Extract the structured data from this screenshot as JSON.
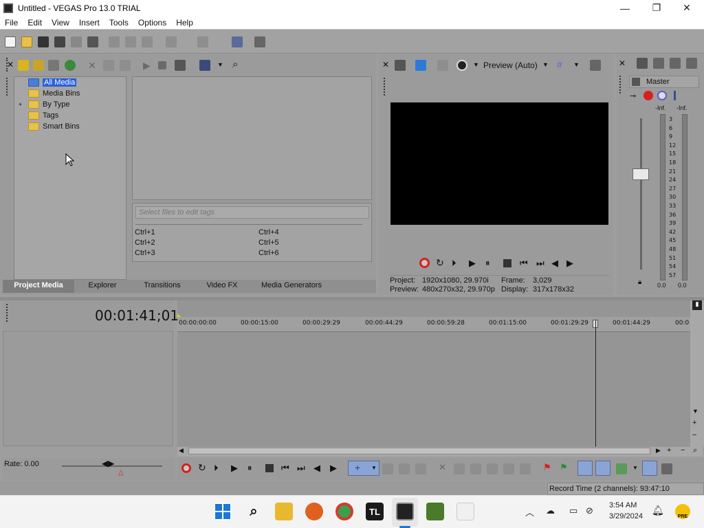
{
  "window": {
    "title": "Untitled - VEGAS Pro 13.0 TRIAL",
    "minimize": "—",
    "maximize": "❐",
    "close": "✕"
  },
  "menu": [
    "File",
    "Edit",
    "View",
    "Insert",
    "Tools",
    "Options",
    "Help"
  ],
  "project_media": {
    "tree": [
      {
        "label": "All Media",
        "selected": true,
        "expandable": false
      },
      {
        "label": "Media Bins",
        "selected": false,
        "expandable": false
      },
      {
        "label": "By Type",
        "selected": false,
        "expandable": true
      },
      {
        "label": "Tags",
        "selected": false,
        "expandable": false
      },
      {
        "label": "Smart Bins",
        "selected": false,
        "expandable": false
      }
    ],
    "tag_placeholder": "Select files to edit tags",
    "shortcuts": [
      "Ctrl+1",
      "Ctrl+2",
      "Ctrl+3",
      "Ctrl+4",
      "Ctrl+5",
      "Ctrl+6"
    ]
  },
  "tabs": [
    "Project Media",
    "Explorer",
    "Transitions",
    "Video FX",
    "Media Generators"
  ],
  "preview": {
    "mode": "Preview (Auto)",
    "project_label": "Project:",
    "project_value": "1920x1080, 29.970i",
    "preview_label": "Preview:",
    "preview_value": "480x270x32, 29.970p",
    "frame_label": "Frame:",
    "frame_value": "3,029",
    "display_label": "Display:",
    "display_value": "317x178x32"
  },
  "mixer": {
    "title": "Master",
    "left_peak": "-Inf.",
    "right_peak": "-Inf.",
    "scale": [
      "3",
      "6",
      "9",
      "12",
      "15",
      "18",
      "21",
      "24",
      "27",
      "30",
      "33",
      "36",
      "39",
      "42",
      "45",
      "48",
      "51",
      "54",
      "57"
    ],
    "left_value": "0.0",
    "right_value": "0.0"
  },
  "timeline": {
    "timecode": "00:01:41;01",
    "ruler": [
      "00:00:00:00",
      "00:00:15:00",
      "00:00:29:29",
      "00:00:44:29",
      "00:00:59:28",
      "00:01:15:00",
      "00:01:29:29",
      "00:01:44:29",
      "00:0"
    ],
    "rate_label": "Rate: 0.00"
  },
  "status": {
    "record_time": "Record Time (2 channels): 93:47:10"
  },
  "taskbar": {
    "apps": [
      "start",
      "search",
      "file-explorer",
      "firefox",
      "chrome",
      "TL",
      "vegas",
      "minecraft",
      "java"
    ],
    "tl_label": "TL",
    "time": "3:54 AM",
    "date": "3/29/2024",
    "badge": "PRE"
  },
  "colors": {
    "accent": "#2b5fd9",
    "panel": "#9b9b9b",
    "record": "#d62020"
  }
}
